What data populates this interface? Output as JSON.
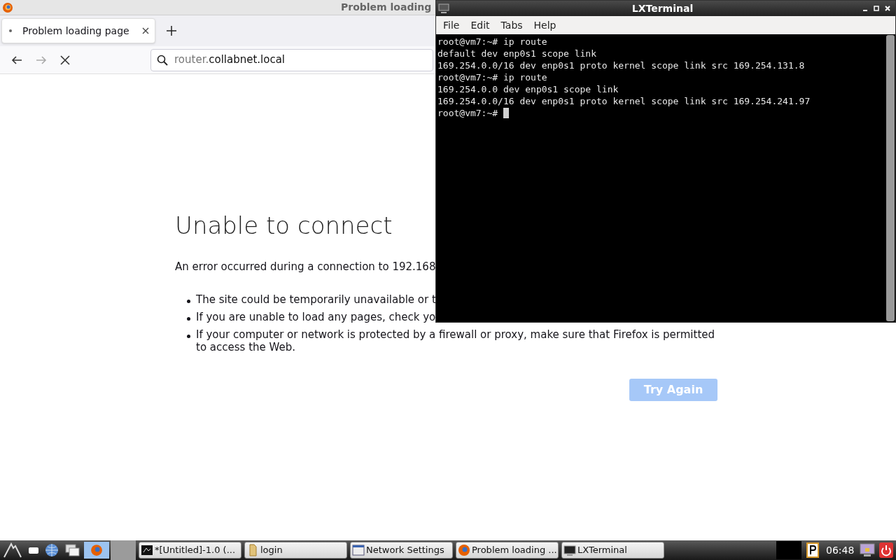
{
  "browser": {
    "title": "Problem loading",
    "tabs": [
      {
        "label": "Problem loading page",
        "selected": true
      }
    ],
    "url": {
      "subdomain": "router.",
      "domain": "collabnet.local"
    },
    "page": {
      "heading": "Unable to connect",
      "message": "An error occurred during a connection to 192.168",
      "bullets": [
        "The site could be temporarily unavailable or t",
        "If you are unable to load any pages, check yo",
        "If your computer or network is protected by a firewall or proxy, make sure that Firefox is permitted to access the Web."
      ],
      "button": "Try Again"
    }
  },
  "terminal": {
    "title": "LXTerminal",
    "menu": [
      "File",
      "Edit",
      "Tabs",
      "Help"
    ],
    "lines": [
      "root@vm7:~# ip route",
      "default dev enp0s1 scope link",
      "169.254.0.0/16 dev enp0s1 proto kernel scope link src 169.254.131.8",
      "root@vm7:~# ip route",
      "169.254.0.0 dev enp0s1 scope link",
      "169.254.0.0/16 dev enp0s1 proto kernel scope link src 169.254.241.97",
      "root@vm7:~# "
    ]
  },
  "taskbar": {
    "tasks": [
      {
        "kind": "editor",
        "label": "*[Untitled]-1.0 (..."
      },
      {
        "kind": "folder",
        "label": "login"
      },
      {
        "kind": "settings",
        "label": "Network Settings"
      },
      {
        "kind": "browser",
        "label": "Problem loading ..."
      },
      {
        "kind": "terminal",
        "label": "LXTerminal"
      }
    ],
    "clock": "06:48"
  }
}
